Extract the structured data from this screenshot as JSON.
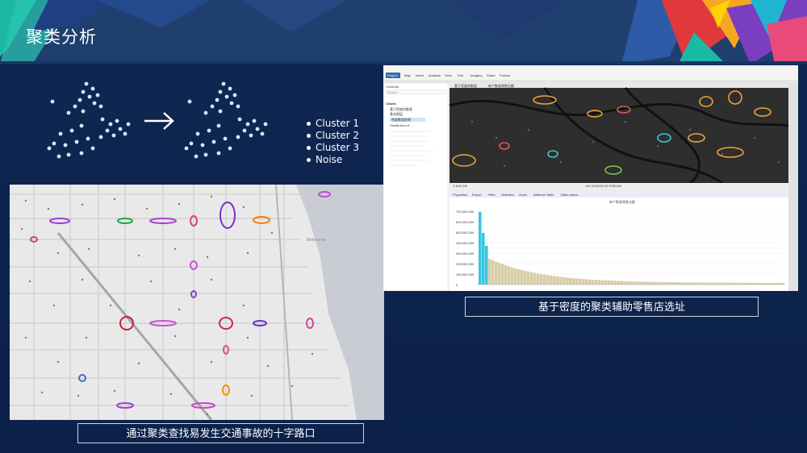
{
  "slide": {
    "title": "聚类分析",
    "legend": [
      "Cluster 1",
      "Cluster 2",
      "Cluster 3",
      "Noise"
    ],
    "map_caption": "通过聚类查找易发生交通事故的十字路口",
    "app_caption": "基于密度的聚类辅助零售店选址"
  },
  "app": {
    "project_tab": "Project",
    "ribbon_tabs": [
      "Map",
      "Insert",
      "Analysis",
      "View",
      "Edit",
      "Imagery",
      "Share",
      "Format"
    ],
    "contents_title": "Contents",
    "search_placeholder": "Search",
    "contents_heading": "Charts",
    "contents_items": [
      "基于密度的聚类",
      "基本图层",
      "密度聚类结果",
      "Distribution of ..."
    ],
    "map_tabs": [
      "基于密度的聚类",
      "每个聚类销售总额"
    ],
    "status_scale": "1:400,128",
    "status_coords": "116.3210254 39.9785445",
    "table_tools": [
      "Properties",
      "Export",
      "Filter",
      "Selection",
      "Zoom",
      "Attribute Table",
      "Data Labels"
    ],
    "chart_title": "每个聚类销售总额",
    "chart_y_ticks": [
      "700,000,000",
      "600,000,000",
      "500,000,000",
      "400,000,000",
      "300,000,000",
      "200,000,000",
      "100,000,000",
      "0"
    ]
  }
}
